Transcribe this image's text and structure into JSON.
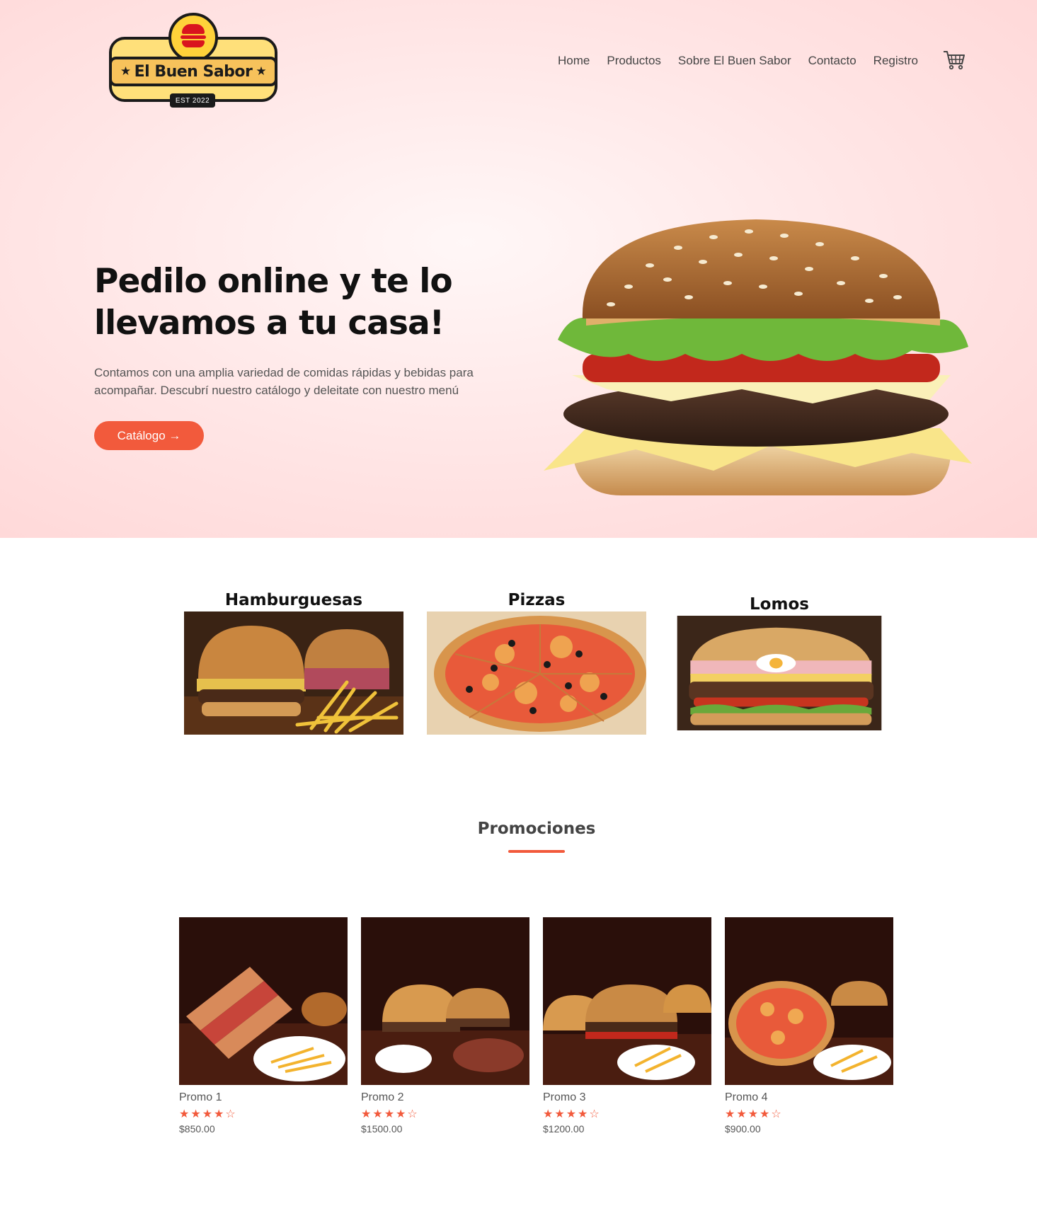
{
  "brand": {
    "name": "El Buen Sabor",
    "est": "EST 2022"
  },
  "nav": {
    "items": [
      "Home",
      "Productos",
      "Sobre El Buen Sabor",
      "Contacto",
      "Registro"
    ],
    "cart_icon": "cart-icon"
  },
  "hero": {
    "title": "Pedilo online y te lo llevamos a tu casa!",
    "description": "Contamos con una amplia variedad de comidas rápidas y bebidas para acompañar. Descubrí nuestro catálogo y deleitate con nuestro menú",
    "button_label": "Catálogo →"
  },
  "categories": [
    {
      "title": "Hamburguesas"
    },
    {
      "title": "Pizzas"
    },
    {
      "title": "Lomos"
    }
  ],
  "promotions": {
    "heading": "Promociones",
    "accent": "#f25a3c",
    "items": [
      {
        "name": "Promo 1",
        "rating": 4,
        "max_rating": 5,
        "price": "$850.00"
      },
      {
        "name": "Promo 2",
        "rating": 4,
        "max_rating": 5,
        "price": "$1500.00"
      },
      {
        "name": "Promo 3",
        "rating": 4,
        "max_rating": 5,
        "price": "$1200.00"
      },
      {
        "name": "Promo 4",
        "rating": 4,
        "max_rating": 5,
        "price": "$900.00"
      }
    ]
  }
}
